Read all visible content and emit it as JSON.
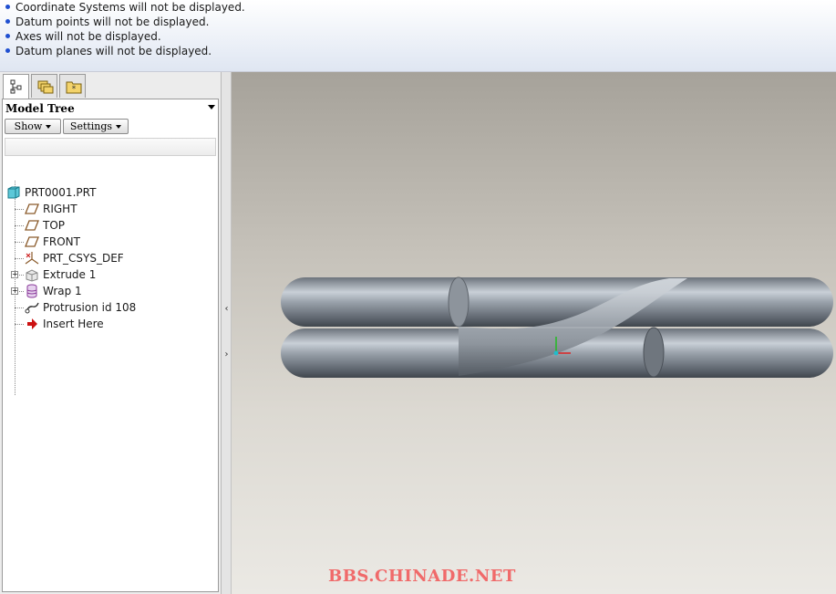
{
  "messages": [
    "Coordinate Systems will not be displayed.",
    "Datum points will not be displayed.",
    "Axes will not be displayed.",
    "Datum planes will not be displayed."
  ],
  "navigator": {
    "tabs": [
      {
        "icon": "model-tree-icon",
        "active": true
      },
      {
        "icon": "folder-browser-icon",
        "active": false
      },
      {
        "icon": "favorites-icon",
        "active": false
      }
    ]
  },
  "model_tree": {
    "title": "Model Tree",
    "show_label": "Show",
    "settings_label": "Settings",
    "root": {
      "label": "PRT0001.PRT",
      "icon": "part-icon"
    },
    "items": [
      {
        "label": "RIGHT",
        "icon": "datum-plane-icon"
      },
      {
        "label": "TOP",
        "icon": "datum-plane-icon"
      },
      {
        "label": "FRONT",
        "icon": "datum-plane-icon"
      },
      {
        "label": "PRT_CSYS_DEF",
        "icon": "csys-icon"
      },
      {
        "label": "Extrude 1",
        "icon": "extrude-icon",
        "expandable": true
      },
      {
        "label": "Wrap 1",
        "icon": "wrap-icon",
        "expandable": true
      },
      {
        "label": "Protrusion id 108",
        "icon": "protrusion-icon"
      },
      {
        "label": "Insert Here",
        "icon": "insert-here-arrow-icon"
      }
    ]
  },
  "watermark": "BBS.CHINADE.NET",
  "colors": {
    "message_bullet": "#1f4fd0",
    "watermark": "#f06a6a",
    "datum_plane": "#8a5a2a",
    "insert_arrow": "#cc1111"
  }
}
